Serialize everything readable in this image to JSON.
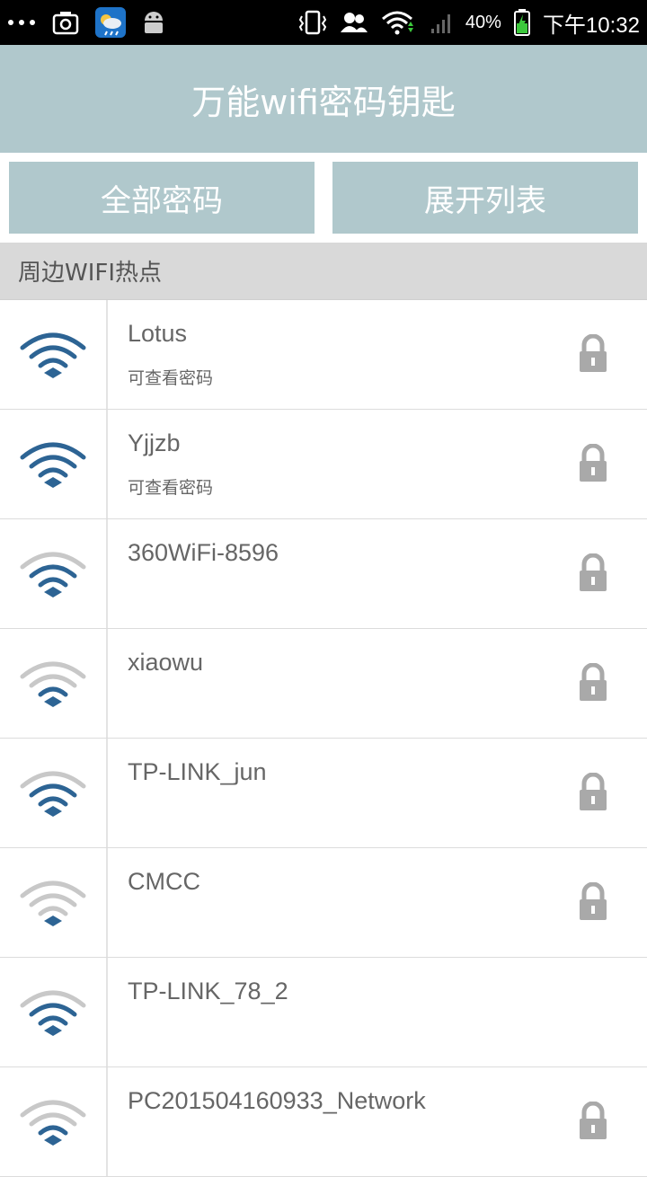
{
  "status_bar": {
    "battery": "40%",
    "time": "下午10:32"
  },
  "header": {
    "title": "万能wifi密码钥匙"
  },
  "buttons": {
    "all_passwords": "全部密码",
    "expand_list": "展开列表"
  },
  "section": {
    "label": "周边WIFI热点"
  },
  "networks": [
    {
      "name": "Lotus",
      "sub": "可查看密码",
      "signal": 4,
      "locked": true
    },
    {
      "name": "Yjjzb",
      "sub": "可查看密码",
      "signal": 4,
      "locked": true
    },
    {
      "name": "360WiFi-8596",
      "sub": "",
      "signal": 3,
      "locked": true
    },
    {
      "name": "xiaowu",
      "sub": "",
      "signal": 2,
      "locked": true
    },
    {
      "name": "TP-LINK_jun",
      "sub": "",
      "signal": 3,
      "locked": true
    },
    {
      "name": "CMCC",
      "sub": "",
      "signal": 1,
      "locked": true
    },
    {
      "name": "TP-LINK_78_2",
      "sub": "",
      "signal": 3,
      "locked": false
    },
    {
      "name": "PC201504160933_Network",
      "sub": "",
      "signal": 2,
      "locked": true
    }
  ],
  "colors": {
    "accent": "#b0c8cc",
    "wifi_active": "#2d6494",
    "wifi_inactive": "#c8c8c8",
    "lock": "#a9a9a9"
  }
}
